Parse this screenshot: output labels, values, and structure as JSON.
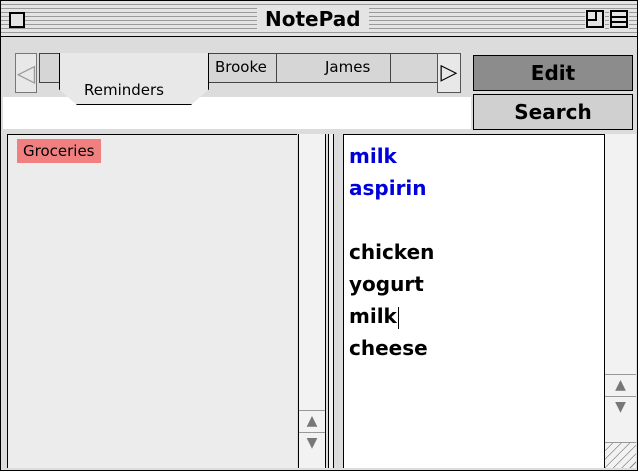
{
  "window": {
    "title": "NotePad"
  },
  "tabs": {
    "items": [
      {
        "label": "Reminders",
        "active": true
      },
      {
        "label": "Brooke"
      },
      {
        "label": "James"
      }
    ],
    "scroll_left_icon": "left-triangle",
    "scroll_right_icon": "right-triangle"
  },
  "buttons": {
    "edit_label": "Edit",
    "search_label": "Search"
  },
  "list": {
    "items": [
      {
        "label": "Groceries",
        "highlight": "#f08080"
      }
    ]
  },
  "note": {
    "lines": [
      {
        "text": "milk",
        "color": "#0000dd"
      },
      {
        "text": "aspirin",
        "color": "#0000dd"
      },
      {
        "text": "",
        "color": "#000000"
      },
      {
        "text": "chicken",
        "color": "#000000"
      },
      {
        "text": "yogurt",
        "color": "#000000"
      },
      {
        "text": "milk",
        "color": "#000000",
        "caret_after": true
      },
      {
        "text": "cheese",
        "color": "#000000"
      }
    ]
  },
  "colors": {
    "selection": "#f08080",
    "recent_items": "#0000dd",
    "active_button": "#8c8c8c"
  }
}
